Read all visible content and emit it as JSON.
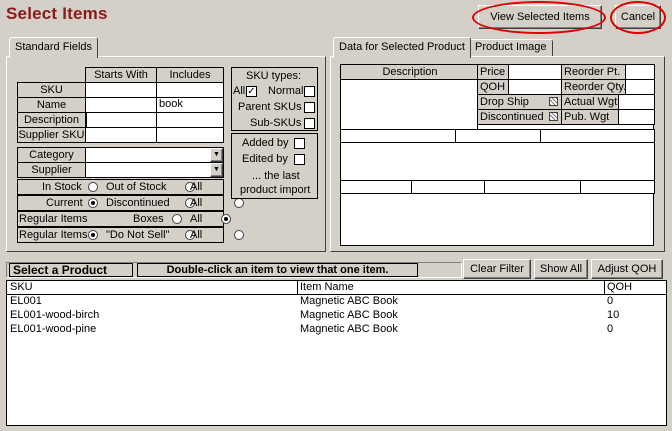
{
  "window": {
    "title": "Select Items"
  },
  "toolbar": {
    "view_selected": "View Selected Items",
    "cancel": "Cancel"
  },
  "tabs_left": [
    {
      "label": "Standard Fields"
    }
  ],
  "tabs_right": [
    {
      "label": "Data for Selected Product"
    },
    {
      "label": "Product Image"
    }
  ],
  "standard": {
    "col_starts": "Starts With",
    "col_includes": "Includes",
    "rows": [
      {
        "label": "SKU",
        "starts": "",
        "includes": ""
      },
      {
        "label": "Name",
        "starts": "",
        "includes": "book"
      },
      {
        "label": "Description",
        "starts": "",
        "includes": ""
      },
      {
        "label": "Supplier SKU",
        "starts": "",
        "includes": ""
      }
    ],
    "category_label": "Category",
    "supplier_label": "Supplier",
    "category_value": "",
    "supplier_value": ""
  },
  "filters": [
    {
      "a": "In Stock",
      "b": "Out of Stock",
      "c": "All",
      "selected": "c"
    },
    {
      "a": "Current",
      "b": "Discontinued",
      "c": "All",
      "selected": "a"
    },
    {
      "a": "Regular Items",
      "b": "Boxes",
      "c": "All",
      "selected": "c"
    },
    {
      "a": "Regular Items",
      "b": "\"Do Not Sell\"",
      "c": "All",
      "selected": "a"
    }
  ],
  "sku_types": {
    "title": "SKU types:",
    "all": "All",
    "normal": "Normal",
    "parent": "Parent SKUs",
    "sub": "Sub-SKUs",
    "all_checked": true
  },
  "import": {
    "added": "Added by",
    "edited": "Edited by",
    "last1": "... the last",
    "last2": "product import"
  },
  "product": {
    "description": "Description",
    "price": "Price",
    "qoh": "QOH",
    "drop_ship": "Drop Ship",
    "discontinued": "Discontinued",
    "reorder_pt": "Reorder Pt.",
    "reorder_qty": "Reorder Qty.",
    "actual_wgt": "Actual Wgt",
    "pub_wgt": "Pub. Wgt"
  },
  "list": {
    "select_label": "Select a Product",
    "hint": "Double-click an item to view that one item.",
    "clear_filter": "Clear Filter",
    "show_all": "Show All",
    "adjust_qoh": "Adjust QOH",
    "headers": {
      "sku": "SKU",
      "name": "Item Name",
      "qoh": "QOH"
    },
    "rows": [
      {
        "sku": "EL001",
        "name": "Magnetic ABC Book",
        "qoh": "0"
      },
      {
        "sku": "EL001-wood-birch",
        "name": "Magnetic ABC Book",
        "qoh": "10"
      },
      {
        "sku": "EL001-wood-pine",
        "name": "Magnetic ABC Book",
        "qoh": "0"
      }
    ]
  },
  "colors": {
    "title": "#8b1a1a",
    "highlight_ring": "#e00000",
    "window_bg": "#d4d0c8"
  }
}
